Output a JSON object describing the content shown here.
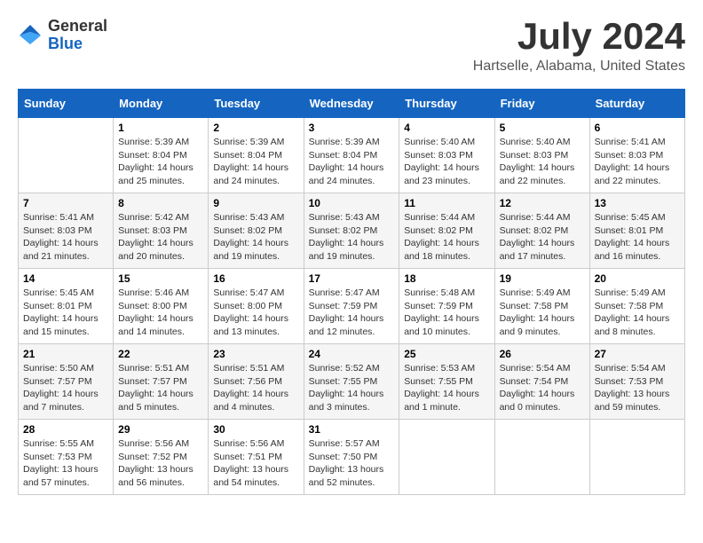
{
  "logo": {
    "general": "General",
    "blue": "Blue"
  },
  "title": {
    "month_year": "July 2024",
    "location": "Hartselle, Alabama, United States"
  },
  "days_of_week": [
    "Sunday",
    "Monday",
    "Tuesday",
    "Wednesday",
    "Thursday",
    "Friday",
    "Saturday"
  ],
  "weeks": [
    [
      {
        "day": "",
        "info": ""
      },
      {
        "day": "1",
        "info": "Sunrise: 5:39 AM\nSunset: 8:04 PM\nDaylight: 14 hours\nand 25 minutes."
      },
      {
        "day": "2",
        "info": "Sunrise: 5:39 AM\nSunset: 8:04 PM\nDaylight: 14 hours\nand 24 minutes."
      },
      {
        "day": "3",
        "info": "Sunrise: 5:39 AM\nSunset: 8:04 PM\nDaylight: 14 hours\nand 24 minutes."
      },
      {
        "day": "4",
        "info": "Sunrise: 5:40 AM\nSunset: 8:03 PM\nDaylight: 14 hours\nand 23 minutes."
      },
      {
        "day": "5",
        "info": "Sunrise: 5:40 AM\nSunset: 8:03 PM\nDaylight: 14 hours\nand 22 minutes."
      },
      {
        "day": "6",
        "info": "Sunrise: 5:41 AM\nSunset: 8:03 PM\nDaylight: 14 hours\nand 22 minutes."
      }
    ],
    [
      {
        "day": "7",
        "info": "Sunrise: 5:41 AM\nSunset: 8:03 PM\nDaylight: 14 hours\nand 21 minutes."
      },
      {
        "day": "8",
        "info": "Sunrise: 5:42 AM\nSunset: 8:03 PM\nDaylight: 14 hours\nand 20 minutes."
      },
      {
        "day": "9",
        "info": "Sunrise: 5:43 AM\nSunset: 8:02 PM\nDaylight: 14 hours\nand 19 minutes."
      },
      {
        "day": "10",
        "info": "Sunrise: 5:43 AM\nSunset: 8:02 PM\nDaylight: 14 hours\nand 19 minutes."
      },
      {
        "day": "11",
        "info": "Sunrise: 5:44 AM\nSunset: 8:02 PM\nDaylight: 14 hours\nand 18 minutes."
      },
      {
        "day": "12",
        "info": "Sunrise: 5:44 AM\nSunset: 8:02 PM\nDaylight: 14 hours\nand 17 minutes."
      },
      {
        "day": "13",
        "info": "Sunrise: 5:45 AM\nSunset: 8:01 PM\nDaylight: 14 hours\nand 16 minutes."
      }
    ],
    [
      {
        "day": "14",
        "info": "Sunrise: 5:45 AM\nSunset: 8:01 PM\nDaylight: 14 hours\nand 15 minutes."
      },
      {
        "day": "15",
        "info": "Sunrise: 5:46 AM\nSunset: 8:00 PM\nDaylight: 14 hours\nand 14 minutes."
      },
      {
        "day": "16",
        "info": "Sunrise: 5:47 AM\nSunset: 8:00 PM\nDaylight: 14 hours\nand 13 minutes."
      },
      {
        "day": "17",
        "info": "Sunrise: 5:47 AM\nSunset: 7:59 PM\nDaylight: 14 hours\nand 12 minutes."
      },
      {
        "day": "18",
        "info": "Sunrise: 5:48 AM\nSunset: 7:59 PM\nDaylight: 14 hours\nand 10 minutes."
      },
      {
        "day": "19",
        "info": "Sunrise: 5:49 AM\nSunset: 7:58 PM\nDaylight: 14 hours\nand 9 minutes."
      },
      {
        "day": "20",
        "info": "Sunrise: 5:49 AM\nSunset: 7:58 PM\nDaylight: 14 hours\nand 8 minutes."
      }
    ],
    [
      {
        "day": "21",
        "info": "Sunrise: 5:50 AM\nSunset: 7:57 PM\nDaylight: 14 hours\nand 7 minutes."
      },
      {
        "day": "22",
        "info": "Sunrise: 5:51 AM\nSunset: 7:57 PM\nDaylight: 14 hours\nand 5 minutes."
      },
      {
        "day": "23",
        "info": "Sunrise: 5:51 AM\nSunset: 7:56 PM\nDaylight: 14 hours\nand 4 minutes."
      },
      {
        "day": "24",
        "info": "Sunrise: 5:52 AM\nSunset: 7:55 PM\nDaylight: 14 hours\nand 3 minutes."
      },
      {
        "day": "25",
        "info": "Sunrise: 5:53 AM\nSunset: 7:55 PM\nDaylight: 14 hours\nand 1 minute."
      },
      {
        "day": "26",
        "info": "Sunrise: 5:54 AM\nSunset: 7:54 PM\nDaylight: 14 hours\nand 0 minutes."
      },
      {
        "day": "27",
        "info": "Sunrise: 5:54 AM\nSunset: 7:53 PM\nDaylight: 13 hours\nand 59 minutes."
      }
    ],
    [
      {
        "day": "28",
        "info": "Sunrise: 5:55 AM\nSunset: 7:53 PM\nDaylight: 13 hours\nand 57 minutes."
      },
      {
        "day": "29",
        "info": "Sunrise: 5:56 AM\nSunset: 7:52 PM\nDaylight: 13 hours\nand 56 minutes."
      },
      {
        "day": "30",
        "info": "Sunrise: 5:56 AM\nSunset: 7:51 PM\nDaylight: 13 hours\nand 54 minutes."
      },
      {
        "day": "31",
        "info": "Sunrise: 5:57 AM\nSunset: 7:50 PM\nDaylight: 13 hours\nand 52 minutes."
      },
      {
        "day": "",
        "info": ""
      },
      {
        "day": "",
        "info": ""
      },
      {
        "day": "",
        "info": ""
      }
    ]
  ]
}
